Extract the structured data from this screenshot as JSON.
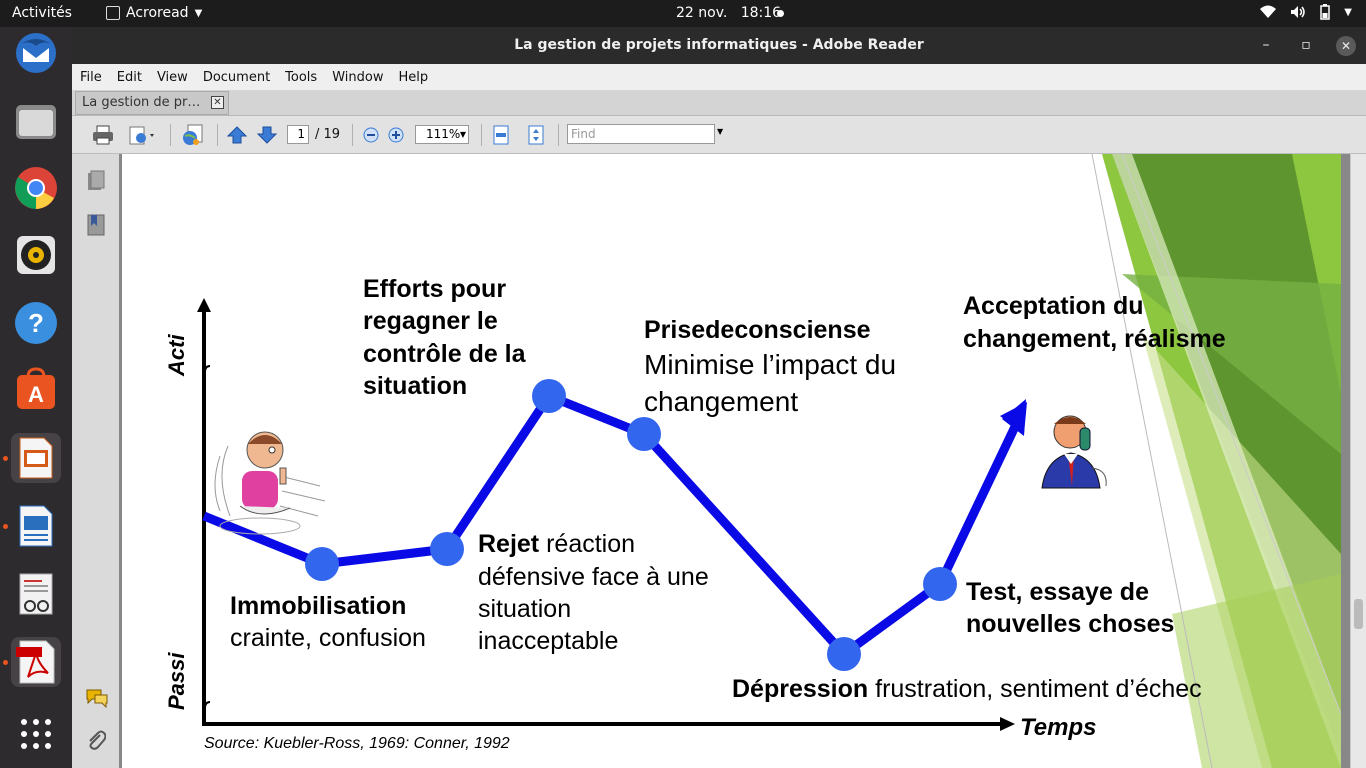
{
  "topbar": {
    "activities": "Activités",
    "app_name": "Acroread",
    "date": "22 nov.",
    "time": "18:16"
  },
  "dock": {
    "items": [
      "thunderbird-icon",
      "files-icon",
      "chrome-icon",
      "rhythmbox-icon",
      "help-icon",
      "software-center-icon",
      "impress-icon",
      "writer-document-icon",
      "document-viewer-icon",
      "adobe-reader-icon",
      "show-applications-icon"
    ]
  },
  "window": {
    "title": "La gestion de projets informatiques - Adobe Reader"
  },
  "menu": [
    "File",
    "Edit",
    "View",
    "Document",
    "Tools",
    "Window",
    "Help"
  ],
  "tab": {
    "label": "La gestion de pr…"
  },
  "toolbar": {
    "page_current": "1",
    "page_total": "/ 19",
    "zoom": "111%",
    "find_placeholder": "Find"
  },
  "slide": {
    "y_top_label": "Acti",
    "y_bottom_label": "Passi",
    "x_label": "Temps",
    "source": "Source:  Kuebler-Ross, 1969: Conner, 1992",
    "immobilisation_title": "Immobilisation",
    "immobilisation_text": "crainte, confusion",
    "rejet_title": "Rejet",
    "rejet_text_1": " réaction",
    "rejet_text_2": "défensive face à une",
    "rejet_text_3": "situation",
    "rejet_text_4": "inacceptable",
    "efforts_1": "Efforts pour",
    "efforts_2": "regagner le",
    "efforts_3": "contrôle de la",
    "efforts_4": "situation",
    "prise_title": "Prisedeconsciense",
    "prise_text_1": "Minimise l’impact du",
    "prise_text_2": "changement",
    "depression_title": "Dépression",
    "depression_text": " frustration, sentiment d’échec",
    "test_1": "Test, essaye de",
    "test_2": "nouvelles choses",
    "acceptation_1": "Acceptation du",
    "acceptation_2": "changement, réalisme"
  },
  "colors": {
    "curve": "#0a0ae6",
    "node": "#3366ee",
    "green_dark": "#5a8f2e",
    "green_light": "#8dc63f"
  }
}
